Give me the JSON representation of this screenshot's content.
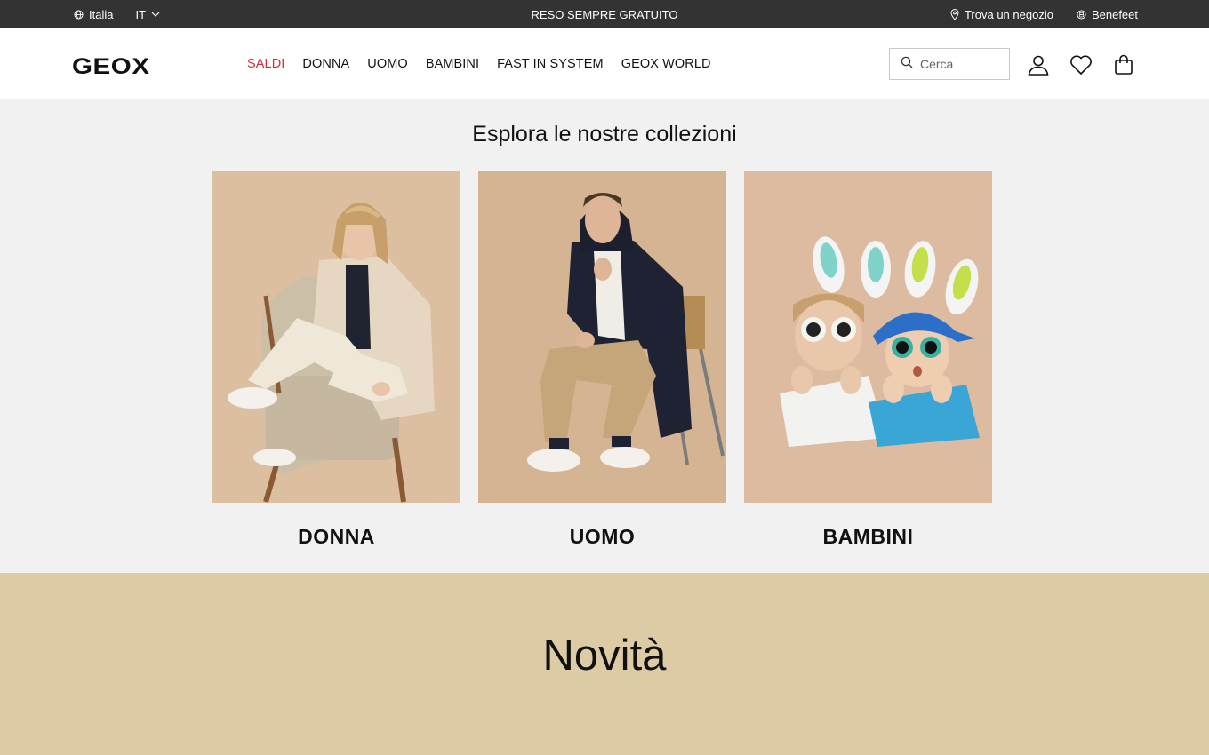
{
  "topbar": {
    "country": "Italia",
    "language": "IT",
    "promo": "RESO SEMPRE GRATUITO",
    "store_locator": "Trova un negozio",
    "loyalty": "Benefeet"
  },
  "header": {
    "logo": "GEOX",
    "nav": [
      "SALDI",
      "DONNA",
      "UOMO",
      "BAMBINI",
      "FAST IN SYSTEM",
      "GEOX WORLD"
    ],
    "search_placeholder": "Cerca"
  },
  "collections": {
    "title": "Esplora le nostre collezioni",
    "cards": [
      {
        "label": "DONNA",
        "image": "woman-seated-armchair"
      },
      {
        "label": "UOMO",
        "image": "man-seated-chair"
      },
      {
        "label": "BAMBINI",
        "image": "children-lying-sunglasses"
      }
    ]
  },
  "novita": {
    "title": "Novità"
  },
  "colors": {
    "topbar": "#333333",
    "sale": "#d62a3f",
    "section_bg": "#f1f1f1",
    "novita_bg": "#ddcba5"
  },
  "icons": [
    "globe-icon",
    "chevron-down-icon",
    "location-pin-icon",
    "benefeet-icon",
    "search-icon",
    "user-icon",
    "heart-icon",
    "bag-icon"
  ]
}
